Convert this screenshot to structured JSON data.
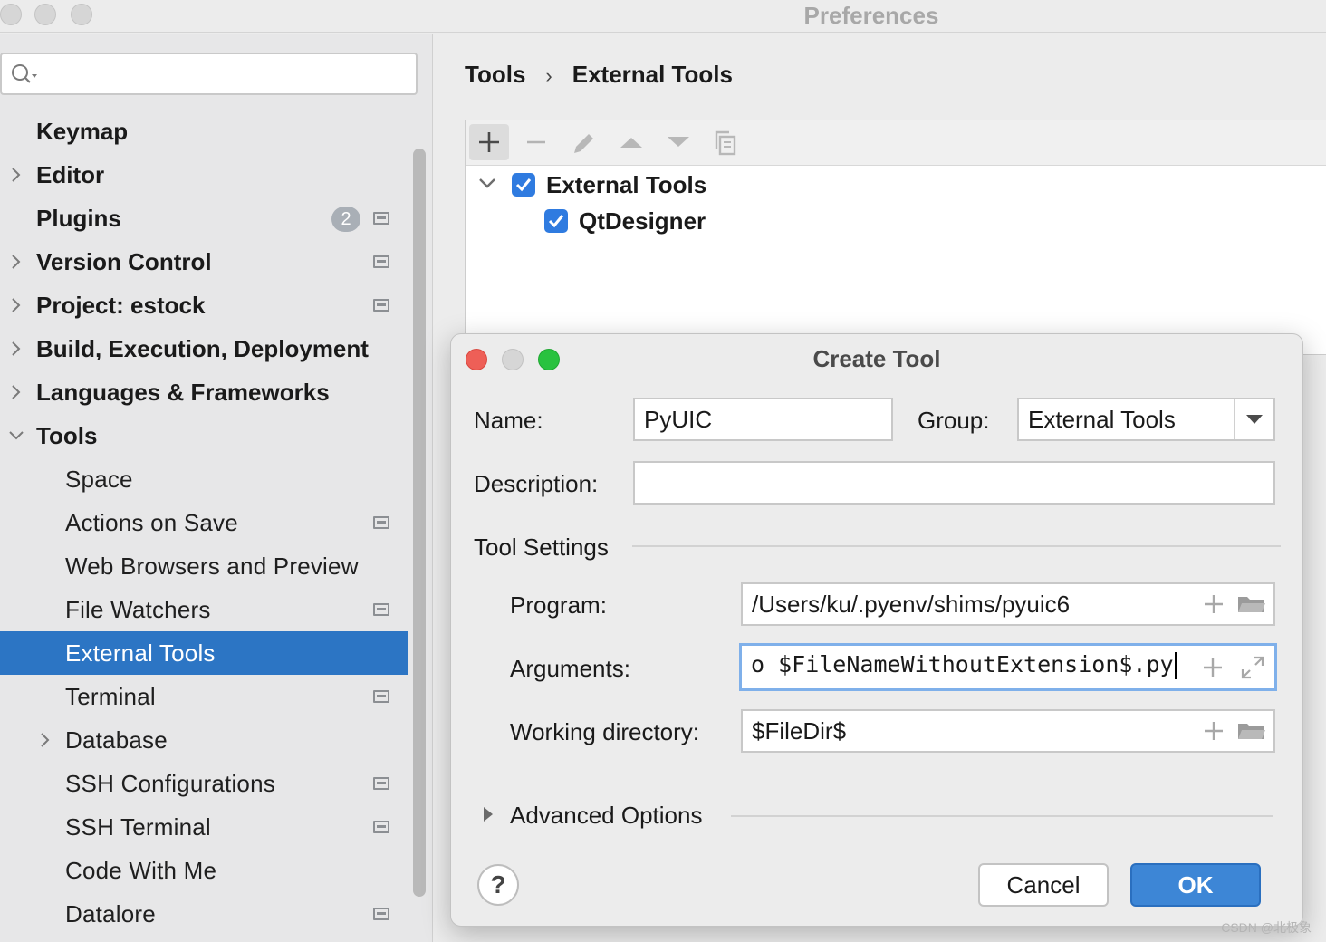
{
  "window": {
    "title": "Preferences"
  },
  "sidebar": {
    "search": {
      "value": "",
      "placeholder": ""
    },
    "items": [
      {
        "label": "Keymap",
        "level": 0,
        "chevron": "none"
      },
      {
        "label": "Editor",
        "level": 0,
        "chevron": "right"
      },
      {
        "label": "Plugins",
        "level": 0,
        "chevron": "none",
        "badge": "2",
        "project_icon": true
      },
      {
        "label": "Version Control",
        "level": 0,
        "chevron": "right",
        "project_icon": true
      },
      {
        "label": "Project: estock",
        "level": 0,
        "chevron": "right",
        "project_icon": true
      },
      {
        "label": "Build, Execution, Deployment",
        "level": 0,
        "chevron": "right"
      },
      {
        "label": "Languages & Frameworks",
        "level": 0,
        "chevron": "right"
      },
      {
        "label": "Tools",
        "level": 0,
        "chevron": "down"
      },
      {
        "label": "Space",
        "level": 1
      },
      {
        "label": "Actions on Save",
        "level": 1,
        "project_icon": true
      },
      {
        "label": "Web Browsers and Preview",
        "level": 1
      },
      {
        "label": "File Watchers",
        "level": 1,
        "project_icon": true
      },
      {
        "label": "External Tools",
        "level": 1,
        "selected": true
      },
      {
        "label": "Terminal",
        "level": 1,
        "project_icon": true
      },
      {
        "label": "Database",
        "level": 1,
        "chevron": "right"
      },
      {
        "label": "SSH Configurations",
        "level": 1,
        "project_icon": true
      },
      {
        "label": "SSH Terminal",
        "level": 1,
        "project_icon": true
      },
      {
        "label": "Code With Me",
        "level": 1
      },
      {
        "label": "Datalore",
        "level": 1,
        "project_icon": true
      }
    ]
  },
  "breadcrumb": {
    "parent": "Tools",
    "separator": "›",
    "current": "External Tools"
  },
  "tool_tree": {
    "group": {
      "label": "External Tools",
      "checked": true
    },
    "child": {
      "label": "QtDesigner",
      "checked": true
    }
  },
  "dialog": {
    "title": "Create Tool",
    "name_label": "Name:",
    "name_value": "PyUIC",
    "group_label": "Group:",
    "group_value": "External Tools",
    "description_label": "Description:",
    "description_value": "",
    "tool_settings_label": "Tool Settings",
    "program_label": "Program:",
    "program_value": "/Users/ku/.pyenv/shims/pyuic6",
    "arguments_label": "Arguments:",
    "arguments_value": "o $FileNameWithoutExtension$.py",
    "working_dir_label": "Working directory:",
    "working_dir_value": "$FileDir$",
    "advanced_label": "Advanced Options",
    "help_label": "?",
    "cancel_label": "Cancel",
    "ok_label": "OK"
  },
  "watermark": "CSDN @北极象",
  "colors": {
    "selection": "#2c75c4",
    "checkbox": "#2f7be0",
    "ok_button": "#3d86d6",
    "close_dot": "#ee5f57",
    "minimize_dot": "#d6d6d6",
    "zoom_dot": "#29c23f"
  }
}
